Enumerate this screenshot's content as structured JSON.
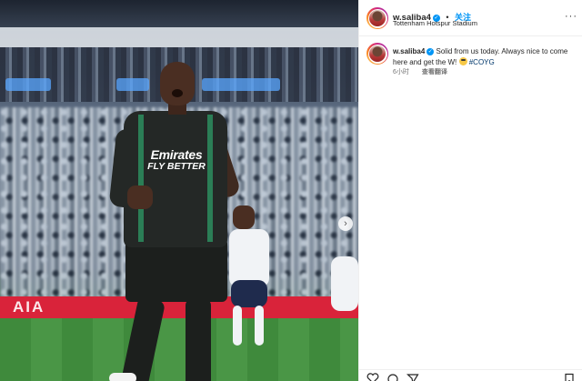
{
  "author": {
    "username": "w.saliba4",
    "verified_icon": "verified-badge-icon",
    "follow_label": "关注",
    "separator": "•",
    "location": "Tottenham Hotspur Stadium"
  },
  "media": {
    "description_icon": "photo-image",
    "sponsor_line1": "Emirates",
    "sponsor_line2": "FLY BETTER",
    "board_text": "AIA",
    "next_icon": "chevron-right-icon"
  },
  "caption": {
    "username": "w.saliba4",
    "text": "Solid from us today. Always nice to come here and get the W!",
    "emoji": "grinning-face-emoji",
    "hashtag": "#COYG",
    "time": "6小时",
    "translate_label": "查看翻译"
  },
  "actions": {
    "icons": [
      "heart-icon",
      "comment-icon",
      "share-icon",
      "save-icon"
    ]
  },
  "colors": {
    "link_blue": "#0095f6",
    "hashtag": "#00376b",
    "muted": "#737373",
    "text": "#262626"
  }
}
